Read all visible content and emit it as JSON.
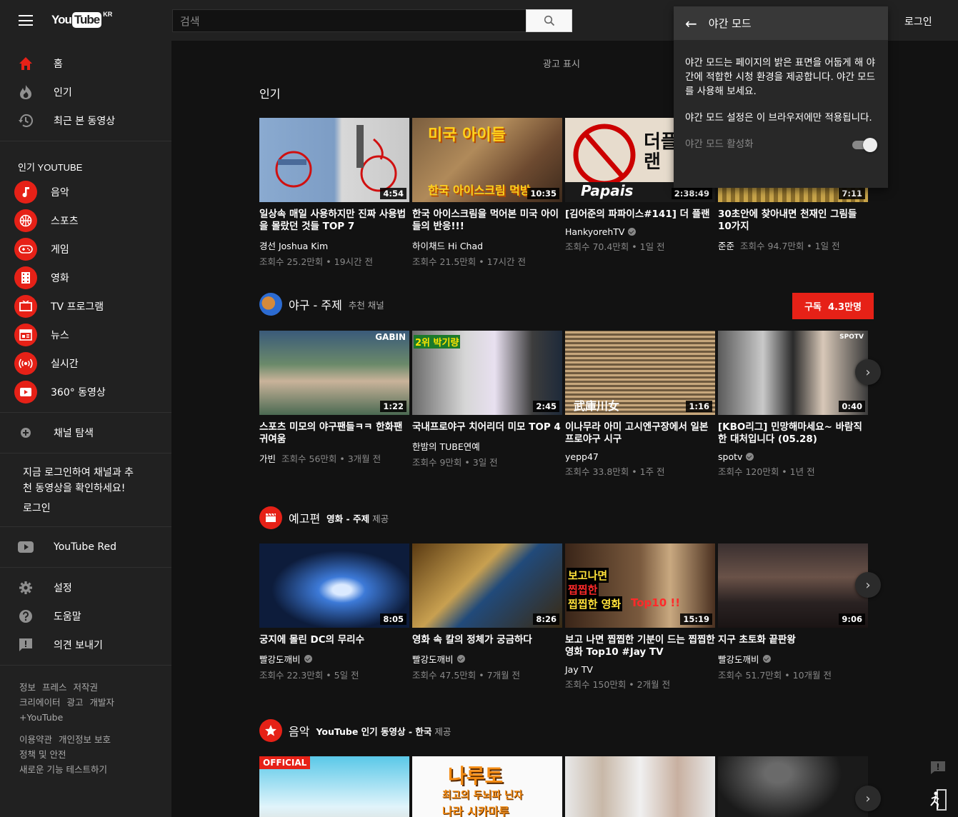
{
  "header": {
    "logo_you": "You",
    "logo_tube": "Tube",
    "logo_region": "KR",
    "search_placeholder": "검색",
    "login": "로그인"
  },
  "sidebar": {
    "main_items": [
      {
        "label": "홈",
        "icon": "home-icon"
      },
      {
        "label": "인기",
        "icon": "fire-icon"
      },
      {
        "label": "최근 본 동영상",
        "icon": "history-icon"
      }
    ],
    "popular_heading": "인기 YOUTUBE",
    "popular_items": [
      {
        "label": "음악",
        "icon": "music-icon"
      },
      {
        "label": "스포츠",
        "icon": "sports-icon"
      },
      {
        "label": "게임",
        "icon": "gamepad-icon"
      },
      {
        "label": "영화",
        "icon": "film-icon"
      },
      {
        "label": "TV 프로그램",
        "icon": "tv-icon"
      },
      {
        "label": "뉴스",
        "icon": "news-icon"
      },
      {
        "label": "실시간",
        "icon": "live-icon"
      },
      {
        "label": "360° 동영상",
        "icon": "360-video-icon"
      }
    ],
    "browse_channels": "채널 탐색",
    "login_msg_line1": "지금 로그인하여 채널과 추",
    "login_msg_line2": "천 동영상을 확인하세요!",
    "login_btn": "로그인",
    "youtube_red": "YouTube Red",
    "bottom_items": [
      {
        "label": "설정",
        "icon": "gear-icon"
      },
      {
        "label": "도움말",
        "icon": "help-icon"
      },
      {
        "label": "의견 보내기",
        "icon": "feedback-icon"
      }
    ],
    "footer_row1": [
      "정보",
      "프레스",
      "저작권"
    ],
    "footer_row2": [
      "크리에이터",
      "광고",
      "개발자"
    ],
    "footer_row3": [
      "+YouTube"
    ],
    "footer_row4": [
      "이용약관",
      "개인정보 보호"
    ],
    "footer_row5": [
      "정책 및 안전"
    ],
    "footer_row6": [
      "새로운 기능 테스트하기"
    ]
  },
  "main": {
    "ad_label": "광고 표시",
    "popular": {
      "title": "인기",
      "videos": [
        {
          "title": "일상속 매일 사용하지만 진짜 사용법을 몰랐던 것들 TOP 7",
          "channel": "경선 Joshua Kim",
          "verified": false,
          "meta": "조회수 25.2만회 • 19시간 전",
          "duration": "4:54"
        },
        {
          "title": "한국 아이스크림을 먹어본 미국 아이들의 반응!!!",
          "channel": "하이채드 Hi Chad",
          "verified": false,
          "meta": "조회수 21.5만회 • 17시간 전",
          "duration": "10:35"
        },
        {
          "title": "[김어준의 파파이스#141] 더 플랜",
          "channel": "HankyorehTV",
          "verified": true,
          "meta": "조회수 70.4만회 • 1일 전",
          "duration": "2:38:49"
        },
        {
          "title": "30초안에 찾아내면 천재인 그림들 10가지",
          "channel": "준준",
          "verified": false,
          "meta_inline": "조회수 94.7만회 • 1일 전",
          "duration": "7:11"
        }
      ]
    },
    "baseball": {
      "title": "야구 - 주제",
      "subtitle": "추천 채널",
      "subscribe": "구독",
      "subscribers": "4.3만명",
      "videos": [
        {
          "title": "스포츠 미모의 야구팬들ㅋㅋ 한화팬 귀여움",
          "channel": "가빈",
          "verified": false,
          "meta_inline": "조회수 56만회 • 3개월 전",
          "duration": "1:22"
        },
        {
          "title": "국내프로야구 치어리더 미모 TOP 4",
          "channel": "한밤의 TUBE연예",
          "verified": false,
          "meta": "조회수 9만회 • 3일 전",
          "duration": "2:45"
        },
        {
          "title": "이나무라 아미 고시엔구장에서 일본 프로야구 시구",
          "channel": "yepp47",
          "verified": false,
          "meta": "조회수 33.8만회 • 1주 전",
          "duration": "1:16"
        },
        {
          "title": "[KBO리그] 민망해마세요~ 바람직한 대처입니다 (05.28)",
          "channel": "spotv",
          "verified": true,
          "meta": "조회수 120만회 • 1년 전",
          "duration": "0:40"
        }
      ]
    },
    "trailers": {
      "title": "예고편",
      "provider": "영화 - 주제",
      "provided": "제공",
      "videos": [
        {
          "title": "궁지에 몰린 DC의 무리수",
          "channel": "빨강도깨비",
          "verified": true,
          "meta": "조회수 22.3만회 • 5일 전",
          "duration": "8:05"
        },
        {
          "title": "영화 속 칼의 정체가 궁금하다",
          "channel": "빨강도깨비",
          "verified": true,
          "meta": "조회수 47.5만회 • 7개월 전",
          "duration": "8:26"
        },
        {
          "title": "보고 나면 찝찝한 기분이 드는 찝찝한 영화 Top10 #Jay TV",
          "channel": "Jay TV",
          "verified": false,
          "meta": "조회수 150만회 • 2개월 전",
          "duration": "15:19"
        },
        {
          "title": "지구 초토화 끝판왕",
          "channel": "빨강도깨비",
          "verified": true,
          "meta": "조회수 51.7만회 • 10개월 전",
          "duration": "9:06"
        }
      ]
    },
    "music": {
      "title": "음악",
      "provider": "YouTube 인기 동영상 - 한국",
      "provided": "제공",
      "thumb_labels": [
        "OFFICIAL",
        "나루토",
        "최고의 두뇌파 닌자",
        "나라 시카마루"
      ]
    },
    "thumb_texts": {
      "t2_top": "미국 아이들",
      "t2_bottom": "한국 아이스크림 먹방",
      "t3_right": "더플랜",
      "t3_bottom": "Papais",
      "b1_tag": "GABIN",
      "b2_rank": "2위 박기량",
      "b3_text": "武庫川女",
      "b4_tag": "SPOTV",
      "tr3_line1": "보고나면",
      "tr3_line2": "찝찝한",
      "tr3_line3": "찝찝한 영화",
      "tr3_top10": "Top10 !!"
    }
  },
  "popup": {
    "title": "야간 모드",
    "para1": "야간 모드는 페이지의 밝은 표면을 어둡게 해 야간에 적합한 시청 환경을 제공합니다. 야간 모드를 사용해 보세요.",
    "para2": "야간 모드 설정은 이 브라우저에만 적용됩니다.",
    "toggle_label": "야간 모드 활성화",
    "toggle_state": "on"
  },
  "colors": {
    "accent": "#e62117",
    "header_bg": "#212121",
    "page_bg": "#121212"
  }
}
